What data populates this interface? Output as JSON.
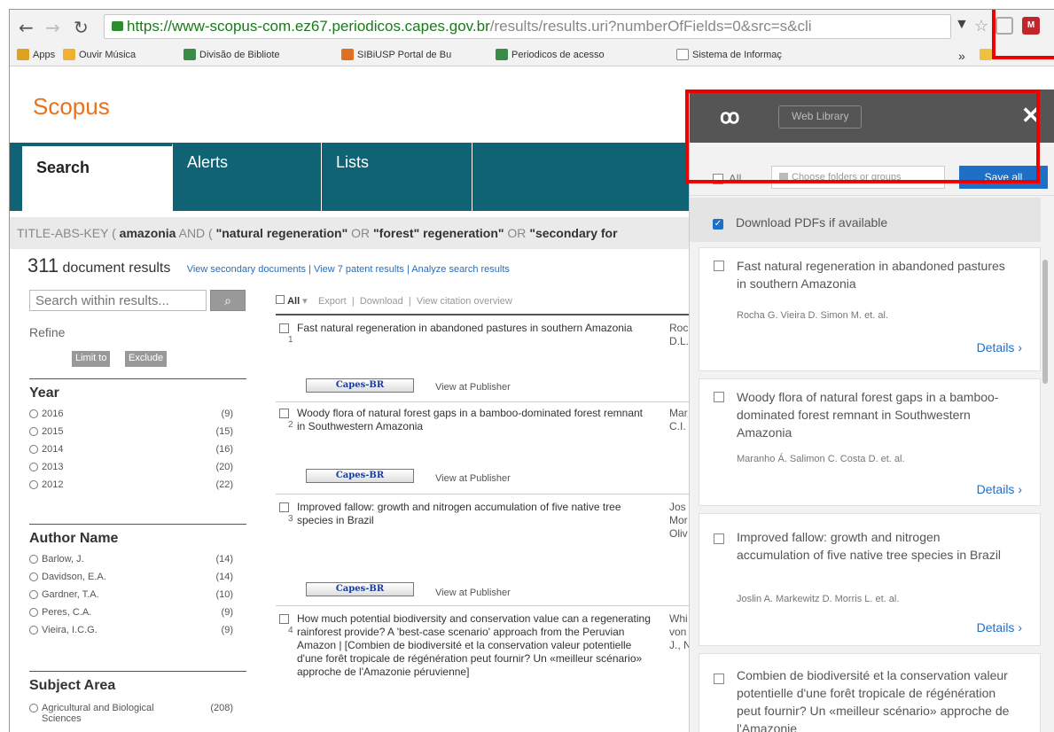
{
  "browser": {
    "url_host": "https://www-scopus-com.ez67.periodicos.capes.gov.br",
    "url_path": "/results/results.uri?numberOfFields=0&src=s&cli",
    "bookmarks": [
      "Apps",
      "Ouvir Música",
      "Divisão de Bibliote",
      "SIBiUSP Portal de Bu",
      "Periodicos de acesso",
      "Sistema de Informaç"
    ],
    "bookmark_more": "»"
  },
  "scopus": {
    "brand": "Scopus",
    "tabs": [
      "Search",
      "Alerts",
      "Lists"
    ],
    "query_prefix": "TITLE-ABS-KEY ( ",
    "query_term1": "amazonia",
    "query_and": " AND ( ",
    "query_term2": "\"natural regeneration\"",
    "query_or1": " OR ",
    "query_term3": "\"forest\" regeneration\"",
    "query_or2": " OR ",
    "query_term4": "\"secondary for",
    "results_count": "311",
    "results_label": " document results",
    "results_links": "View secondary documents  |  View 7 patent results  |  Analyze search results",
    "search_within_placeholder": "Search within results...",
    "refine": "Refine",
    "limit_to": "Limit to",
    "exclude": "Exclude",
    "facets": [
      {
        "title": "Year",
        "items": [
          [
            "2016",
            "(9)"
          ],
          [
            "2015",
            "(15)"
          ],
          [
            "2014",
            "(16)"
          ],
          [
            "2013",
            "(20)"
          ],
          [
            "2012",
            "(22)"
          ]
        ]
      },
      {
        "title": "Author Name",
        "items": [
          [
            "Barlow, J.",
            "(14)"
          ],
          [
            "Davidson, E.A.",
            "(14)"
          ],
          [
            "Gardner, T.A.",
            "(10)"
          ],
          [
            "Peres, C.A.",
            "(9)"
          ],
          [
            "Vieira, I.C.G.",
            "(9)"
          ]
        ]
      },
      {
        "title": "Subject Area",
        "items": [
          [
            "Agricultural and Biological Sciences",
            "(208)"
          ]
        ]
      }
    ],
    "toolbar": {
      "all": "All",
      "export": "Export",
      "download": "Download",
      "citation": "View citation overview"
    },
    "capes_label": "Capes-BR",
    "view_pub": "View at Publisher",
    "results": [
      {
        "num": "1",
        "title": "Fast natural regeneration in abandoned pastures in southern Amazonia",
        "authors": "Roc D.L."
      },
      {
        "num": "2",
        "title": "Woody flora of natural forest gaps in a bamboo-dominated forest remnant in Southwestern Amazonia",
        "authors": "Mar C.I."
      },
      {
        "num": "3",
        "title": "Improved fallow: growth and nitrogen accumulation of five native tree species in Brazil",
        "authors": "Jos Mor Oliv"
      },
      {
        "num": "4",
        "title": "How much potential biodiversity and conservation value can a regenerating rainforest provide? A 'best-case scenario' approach from the Peruvian Amazon | [Combien de biodiversité et la conservation valeur potentielle d'une forêt tropicale de régénération peut fournir? Un «meilleur scénario» approche de l'Amazonie péruvienne]",
        "authors": "Whi von J., N"
      }
    ]
  },
  "mendeley": {
    "web_library": "Web Library",
    "all": "All",
    "folder_placeholder": "Choose folders or groups",
    "save_all": "Save all",
    "download_pdfs": "Download PDFs if available",
    "details": "Details ›",
    "cards": [
      {
        "title": "Fast natural regeneration in abandoned pastures in southern Amazonia",
        "authors": "Rocha G.   Vieira D.   Simon M.   et. al."
      },
      {
        "title": "Woody flora of natural forest gaps in a bamboo-dominated forest remnant in Southwestern Amazonia",
        "authors": "Maranho Á.   Salimon C.   Costa D.   et. al."
      },
      {
        "title": "Improved fallow: growth and nitrogen accumulation of five native tree species in Brazil",
        "authors": "Joslin A.   Markewitz D.   Morris L.   et. al."
      },
      {
        "title": "Combien de biodiversité et la conservation valeur potentielle d'une forêt tropicale de régénération peut fournir? Un «meilleur scénario» approche de l'Amazonie"
      }
    ]
  },
  "colors": {
    "scopus_teal": "#106275",
    "scopus_orange": "#e9711c",
    "mendeley_blue": "#1e6fc8",
    "highlight_red": "#e00000"
  }
}
